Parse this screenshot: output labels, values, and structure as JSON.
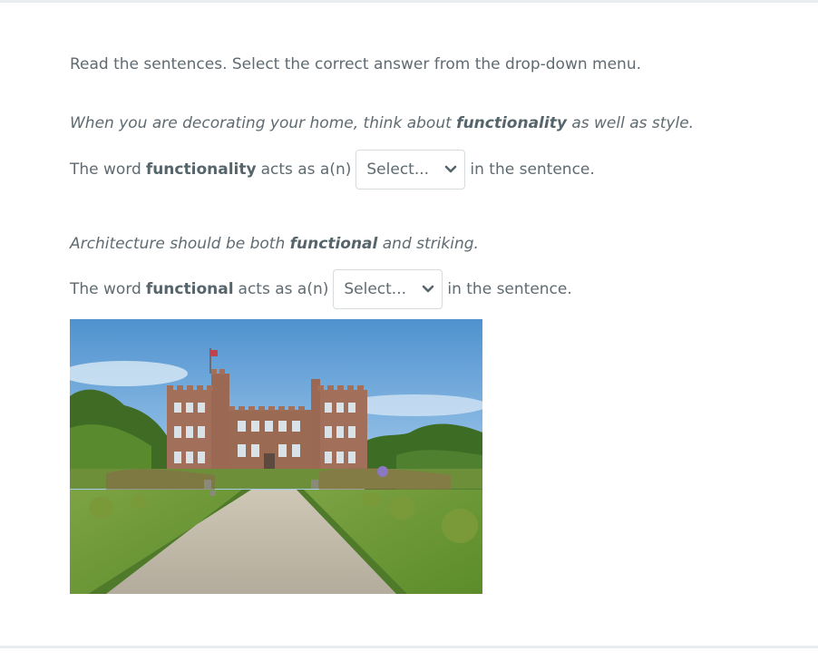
{
  "instructions": "Read the sentences. Select the correct answer from the drop-down menu.",
  "items": [
    {
      "sentence_pre": "When you are decorating your home, think about ",
      "sentence_bold": "functionality",
      "sentence_post": " as well as style.",
      "q_pre": "The word",
      "q_bold": "functionality",
      "q_mid": "acts as a(n)",
      "select_value": "Select...",
      "q_post": "in the sentence."
    },
    {
      "sentence_pre": "Architecture should be both ",
      "sentence_bold": "functional",
      "sentence_post": " and striking.",
      "q_pre": "The word",
      "q_bold": "functional",
      "q_mid": "acts as a(n)",
      "select_value": "Select...",
      "q_post": "in the sentence."
    }
  ],
  "image": {
    "subject": "castle-photo"
  }
}
